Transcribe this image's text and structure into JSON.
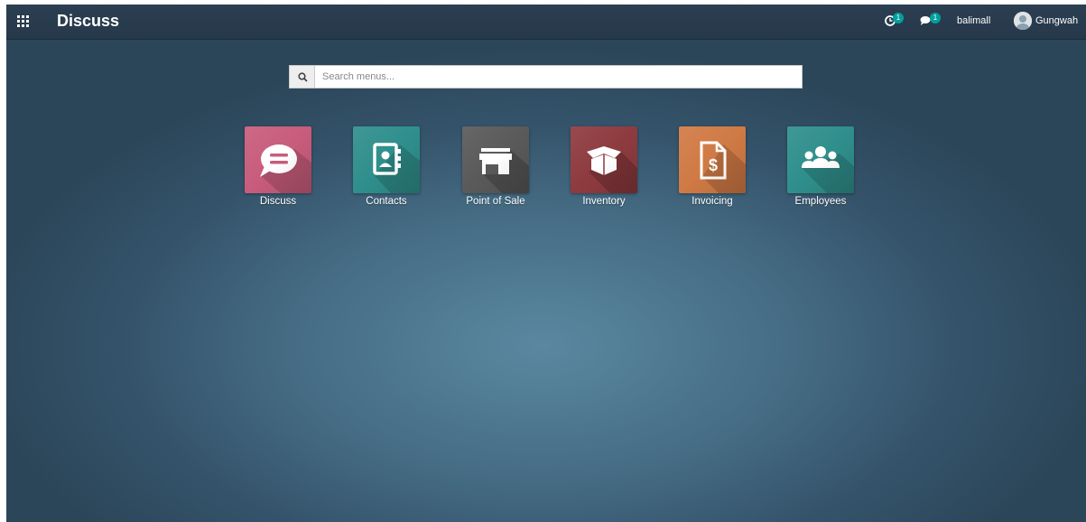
{
  "navbar": {
    "app_title": "Discuss",
    "activity_badge": "1",
    "messages_badge": "1",
    "company": "balimall",
    "user": "Gungwah"
  },
  "search": {
    "placeholder": "Search menus..."
  },
  "apps": [
    {
      "label": "Discuss",
      "icon": "chat-bubble-icon",
      "color": "#c85c7c"
    },
    {
      "label": "Contacts",
      "icon": "address-book-icon",
      "color": "#2f8f8c"
    },
    {
      "label": "Point of Sale",
      "icon": "store-icon",
      "color": "#5a5a5a"
    },
    {
      "label": "Inventory",
      "icon": "box-icon",
      "color": "#8e3b3f"
    },
    {
      "label": "Invoicing",
      "icon": "invoice-icon",
      "color": "#d07a45"
    },
    {
      "label": "Employees",
      "icon": "users-icon",
      "color": "#2f8f8c"
    }
  ]
}
